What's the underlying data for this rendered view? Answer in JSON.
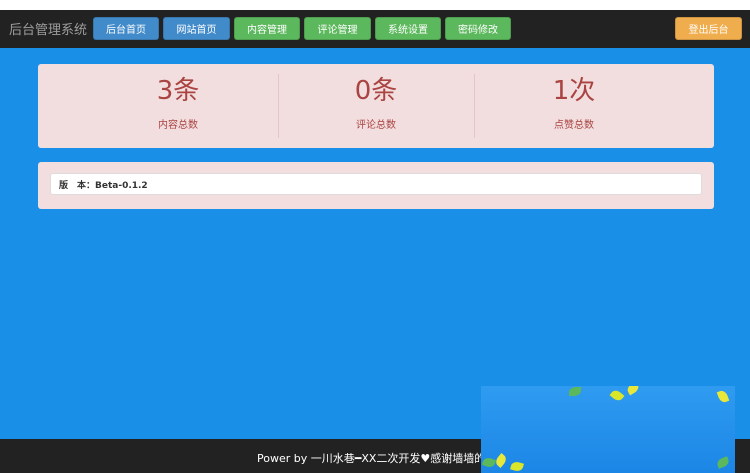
{
  "navbar": {
    "brand": "后台管理系统",
    "buttons": [
      {
        "label": "后台首页",
        "color": "#428bca"
      },
      {
        "label": "网站首页",
        "color": "#428bca"
      },
      {
        "label": "内容管理",
        "color": "#5cb85c"
      },
      {
        "label": "评论管理",
        "color": "#5cb85c"
      },
      {
        "label": "系统设置",
        "color": "#5cb85c"
      },
      {
        "label": "密码修改",
        "color": "#5cb85c"
      }
    ],
    "logout_label": "登出后台",
    "logout_color": "#f0ad4e"
  },
  "stats": [
    {
      "value": "3条",
      "label": "内容总数"
    },
    {
      "value": "0条",
      "label": "评论总数"
    },
    {
      "value": "1次",
      "label": "点赞总数"
    }
  ],
  "version": {
    "text": "版　本：Beta-0.1.2"
  },
  "footer": {
    "text": "Power by 一川水巷━XX二次开发♥感谢墙墙的使"
  },
  "colors": {
    "page_background": "#1a8fe8",
    "navbar_background": "#222222",
    "panel_background": "#f2dede",
    "stat_text": "#a94442"
  },
  "decor_widget": {
    "icon": "leaves-decoration-icon"
  }
}
